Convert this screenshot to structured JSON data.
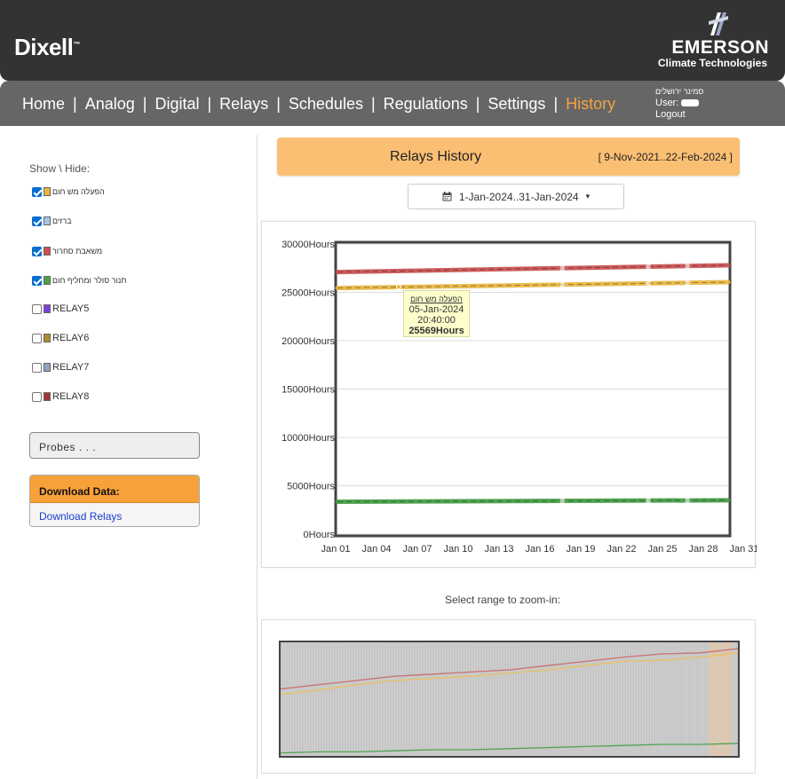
{
  "header": {
    "brand": "Dixell",
    "brand_mark": "™",
    "partner_name": "EMERSON",
    "partner_sub": "Climate Technologies"
  },
  "nav": {
    "items": [
      "Home",
      "Analog",
      "Digital",
      "Relays",
      "Schedules",
      "Regulations",
      "Settings",
      "History"
    ],
    "active": "History",
    "separator": "|"
  },
  "user": {
    "location": "סמינר ירושלים",
    "user_label": "User:",
    "logout": "Logout"
  },
  "sidebar": {
    "show_hide_title": "Show \\ Hide:",
    "relays": [
      {
        "label": "הפעלה מש חום",
        "checked": true,
        "color": "#e8b53b",
        "hebrew": true
      },
      {
        "label": "ברזים",
        "checked": true,
        "color": "#a8c4e6",
        "hebrew": true
      },
      {
        "label": "משאבת סחרור",
        "checked": true,
        "color": "#d14e4e",
        "hebrew": true
      },
      {
        "label": "תנור סולר ומחליף חום",
        "checked": true,
        "color": "#4ca24c",
        "hebrew": true
      },
      {
        "label": "RELAY5",
        "checked": false,
        "color": "#7b3fe0",
        "hebrew": false
      },
      {
        "label": "RELAY6",
        "checked": false,
        "color": "#b08a2e",
        "hebrew": false
      },
      {
        "label": "RELAY7",
        "checked": false,
        "color": "#8fa2c0",
        "hebrew": false
      },
      {
        "label": "RELAY8",
        "checked": false,
        "color": "#a33535",
        "hebrew": false
      }
    ],
    "probes_label": "Probes . . .",
    "download_title": "Download Data:",
    "download_link": "Download Relays"
  },
  "history": {
    "title": "Relays History",
    "range": "[ 9-Nov-2021..22-Feb-2024 ]",
    "date_picker": "1-Jan-2024..31-Jan-2024",
    "zoom_label": "Select range to zoom-in:"
  },
  "tooltip": {
    "relay": "הפעלה מש חום",
    "date": "05-Jan-2024",
    "time": "20:40:00",
    "value": "25569Hours"
  },
  "chart_data": {
    "type": "line",
    "y_unit_suffix": "Hours",
    "ylim": [
      0,
      30000
    ],
    "y_ticks": [
      0,
      5000,
      10000,
      15000,
      20000,
      25000,
      30000
    ],
    "y_tick_labels": [
      "0Hours",
      "5000Hours",
      "10000Hours",
      "15000Hours",
      "20000Hours",
      "25000Hours",
      "30000Hours"
    ],
    "x_tick_labels": [
      "Jan 01",
      "Jan 04",
      "Jan 07",
      "Jan 10",
      "Jan 13",
      "Jan 16",
      "Jan 19",
      "Jan 22",
      "Jan 25",
      "Jan 28",
      "Jan 31"
    ],
    "xlim_days": [
      1,
      32
    ],
    "grid": true,
    "series": [
      {
        "name": "משאבת סחרור",
        "color": "#c94b4b",
        "x_days": [
          1,
          32
        ],
        "values": [
          27100,
          27800
        ]
      },
      {
        "name": "הפעלה מש חום",
        "color": "#e8b53b",
        "x_days": [
          1,
          32
        ],
        "values": [
          25450,
          26050
        ]
      },
      {
        "name": "תנור סולר ומחליף חום",
        "color": "#3f9a3f",
        "x_days": [
          1,
          32
        ],
        "values": [
          3350,
          3500
        ]
      }
    ]
  },
  "overview_data": {
    "series": [
      {
        "color": "#c97070",
        "values": [
          0.62,
          0.66,
          0.7,
          0.74,
          0.76,
          0.78,
          0.8,
          0.84,
          0.88,
          0.92,
          0.95,
          0.96,
          1.0
        ]
      },
      {
        "color": "#e8c062",
        "values": [
          0.57,
          0.61,
          0.66,
          0.7,
          0.72,
          0.74,
          0.77,
          0.8,
          0.84,
          0.88,
          0.89,
          0.92,
          0.96
        ]
      },
      {
        "color": "#4fa24f",
        "values": [
          0.02,
          0.03,
          0.03,
          0.04,
          0.05,
          0.05,
          0.06,
          0.07,
          0.08,
          0.09,
          0.1,
          0.1,
          0.11
        ]
      }
    ],
    "selection_fraction": [
      0.935,
      0.985
    ]
  }
}
